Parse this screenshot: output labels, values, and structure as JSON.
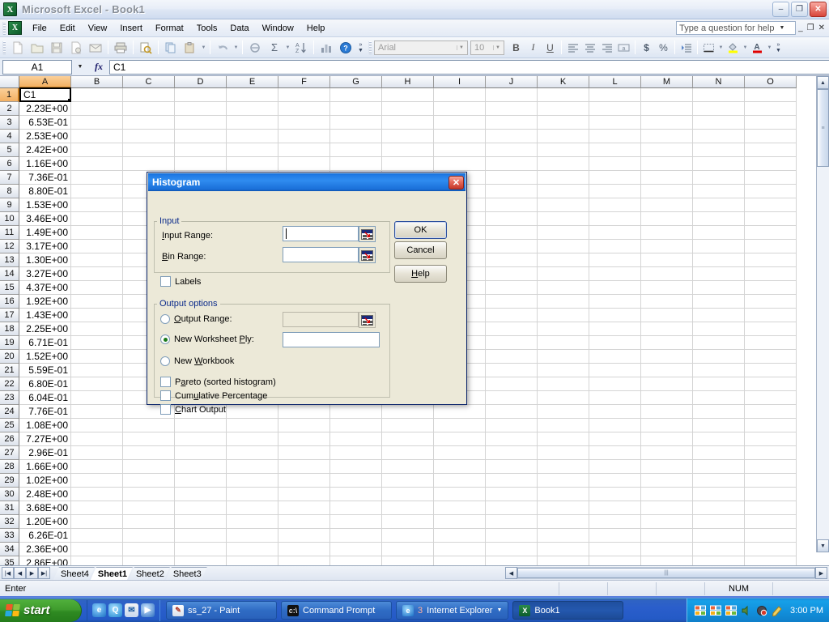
{
  "window": {
    "title": "Microsoft Excel - Book1",
    "app_icon": "excel-icon",
    "minimize": "–",
    "restore": "❐",
    "close": "✕"
  },
  "menu": {
    "items": [
      "File",
      "Edit",
      "View",
      "Insert",
      "Format",
      "Tools",
      "Data",
      "Window",
      "Help"
    ],
    "ask_placeholder": "Type a question for help",
    "mdi_minimize": "_",
    "mdi_restore": "❐",
    "mdi_close": "✕"
  },
  "standard_toolbar": {
    "buttons": [
      "new-icon",
      "open-icon",
      "save-icon",
      "permission-icon",
      "email-icon",
      "print-icon",
      "print-preview-icon",
      "spelling-icon",
      "copy-icon",
      "paste-icon",
      "undo-icon",
      "hyperlink-icon",
      "autosum-icon",
      "sort-ascending-icon",
      "chart-wizard-icon",
      "help-icon"
    ],
    "overflow": "»"
  },
  "formatting_toolbar": {
    "font_name": "Arial",
    "font_size": "10",
    "bold": "B",
    "italic": "I",
    "underline": "U",
    "align_left": "≡",
    "align_center": "≡",
    "align_right": "≡",
    "merge_center": "↔a↔",
    "currency": "$",
    "percent": "%",
    "indent": "⇥",
    "borders": "▦",
    "fill_color": "A",
    "font_color": "A",
    "overflow": "»"
  },
  "formula_bar": {
    "name_box": "A1",
    "fx_label": "fx",
    "formula_value": "C1"
  },
  "sheet": {
    "columns": [
      "A",
      "B",
      "C",
      "D",
      "E",
      "F",
      "G",
      "H",
      "I",
      "J",
      "K",
      "L",
      "M",
      "N",
      "O"
    ],
    "selected_column": "A",
    "selected_row": 1,
    "rows": [
      {
        "n": "1",
        "a": "C1"
      },
      {
        "n": "2",
        "a": "2.23E+00"
      },
      {
        "n": "3",
        "a": "6.53E-01"
      },
      {
        "n": "4",
        "a": "2.53E+00"
      },
      {
        "n": "5",
        "a": "2.42E+00"
      },
      {
        "n": "6",
        "a": "1.16E+00"
      },
      {
        "n": "7",
        "a": "7.36E-01"
      },
      {
        "n": "8",
        "a": "8.80E-01"
      },
      {
        "n": "9",
        "a": "1.53E+00"
      },
      {
        "n": "10",
        "a": "3.46E+00"
      },
      {
        "n": "11",
        "a": "1.49E+00"
      },
      {
        "n": "12",
        "a": "3.17E+00"
      },
      {
        "n": "13",
        "a": "1.30E+00"
      },
      {
        "n": "14",
        "a": "3.27E+00"
      },
      {
        "n": "15",
        "a": "4.37E+00"
      },
      {
        "n": "16",
        "a": "1.92E+00"
      },
      {
        "n": "17",
        "a": "1.43E+00"
      },
      {
        "n": "18",
        "a": "2.25E+00"
      },
      {
        "n": "19",
        "a": "6.71E-01"
      },
      {
        "n": "20",
        "a": "1.52E+00"
      },
      {
        "n": "21",
        "a": "5.59E-01"
      },
      {
        "n": "22",
        "a": "6.80E-01"
      },
      {
        "n": "23",
        "a": "6.04E-01"
      },
      {
        "n": "24",
        "a": "7.76E-01"
      },
      {
        "n": "25",
        "a": "1.08E+00"
      },
      {
        "n": "26",
        "a": "7.27E+00"
      },
      {
        "n": "27",
        "a": "2.96E-01"
      },
      {
        "n": "28",
        "a": "1.66E+00"
      },
      {
        "n": "29",
        "a": "1.02E+00"
      },
      {
        "n": "30",
        "a": "2.48E+00"
      },
      {
        "n": "31",
        "a": "3.68E+00"
      },
      {
        "n": "32",
        "a": "1.20E+00"
      },
      {
        "n": "33",
        "a": "6.26E-01"
      },
      {
        "n": "34",
        "a": "2.36E+00"
      },
      {
        "n": "35",
        "a": "2.86E+00"
      }
    ]
  },
  "sheet_tabs": {
    "first_label": "|◀",
    "prev_label": "◀",
    "next_label": "▶",
    "last_label": "▶|",
    "tabs": [
      "Sheet4",
      "Sheet1",
      "Sheet2",
      "Sheet3"
    ],
    "active": "Sheet1"
  },
  "scrollbars": {
    "v_up": "▲",
    "v_down": "▼",
    "h_left": "◀",
    "h_right": "▶",
    "thumb_grip": "≡"
  },
  "status_bar": {
    "mode": "Enter",
    "num_lock": "NUM"
  },
  "dialog": {
    "title": "Histogram",
    "close_label": "✕",
    "input_group": {
      "legend": "Input",
      "input_range_label": "Input Range:",
      "input_range_value": "",
      "bin_range_label": "Bin Range:",
      "bin_range_value": "",
      "labels_checkbox": "Labels",
      "labels_checked": false
    },
    "output_group": {
      "legend": "Output options",
      "output_range_label": "Output Range:",
      "output_range_value": "",
      "output_range_selected": false,
      "new_worksheet_label": "New Worksheet Ply:",
      "new_worksheet_value": "",
      "new_worksheet_selected": true,
      "new_workbook_label": "New Workbook",
      "new_workbook_selected": false,
      "pareto_label": "Pareto (sorted histogram)",
      "pareto_checked": false,
      "cumulative_label": "Cumulative Percentage",
      "cumulative_checked": false,
      "chart_output_label": "Chart Output",
      "chart_output_checked": false
    },
    "buttons": {
      "ok": "OK",
      "cancel": "Cancel",
      "help": "Help"
    }
  },
  "taskbar": {
    "start_label": "start",
    "quick_launch": [
      "internet-explorer-icon",
      "media-quick-icon",
      "outlook-express-icon",
      "media-player-icon"
    ],
    "tasks": [
      {
        "label": "ss_27 - Paint",
        "icon": "paint-icon",
        "active": false
      },
      {
        "label": "Command Prompt",
        "icon": "command-prompt-icon",
        "active": false
      },
      {
        "label": "Internet Explorer",
        "count": "3",
        "icon": "internet-explorer-icon",
        "active": false,
        "group": true
      },
      {
        "label": "Book1",
        "icon": "excel-icon",
        "active": true
      }
    ],
    "tray_icons": [
      "network-icon",
      "network-icon",
      "network-icon",
      "volume-icon",
      "shield-icon",
      "notes-icon"
    ],
    "clock": "3:00 PM"
  }
}
